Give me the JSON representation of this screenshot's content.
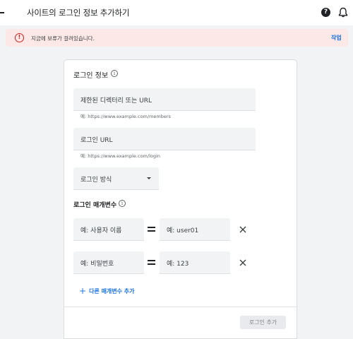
{
  "header": {
    "title": "사이트의 로그인 정보 추가하기",
    "help_icon": "help-icon",
    "notification_icon": "bell-icon"
  },
  "alert": {
    "icon": "error-icon",
    "message": "지금에 보류가 걸려있습니다.",
    "action": "작업"
  },
  "login_info": {
    "title": "로그인 정보",
    "restricted_url": {
      "placeholder": "제한된 디렉터리 또는 URL",
      "hint": "예: https://www.example.com/members"
    },
    "login_url": {
      "placeholder": "로그인 URL",
      "hint": "예: https://www.example.com/login"
    },
    "login_method": {
      "label": "로그인 방식"
    }
  },
  "params": {
    "title": "로그인 매개변수",
    "rows": [
      {
        "name_placeholder": "예: 사용자 이름",
        "value_placeholder": "예: user01"
      },
      {
        "name_placeholder": "예: 비밀번호",
        "value_placeholder": "예: 123"
      }
    ],
    "add_label": "다른 매개변수 추가"
  },
  "footer": {
    "submit_label": "로그인 추가"
  },
  "colors": {
    "accent": "#1a73e8",
    "error": "#c5221f",
    "alert_bg": "#fce8e6"
  }
}
